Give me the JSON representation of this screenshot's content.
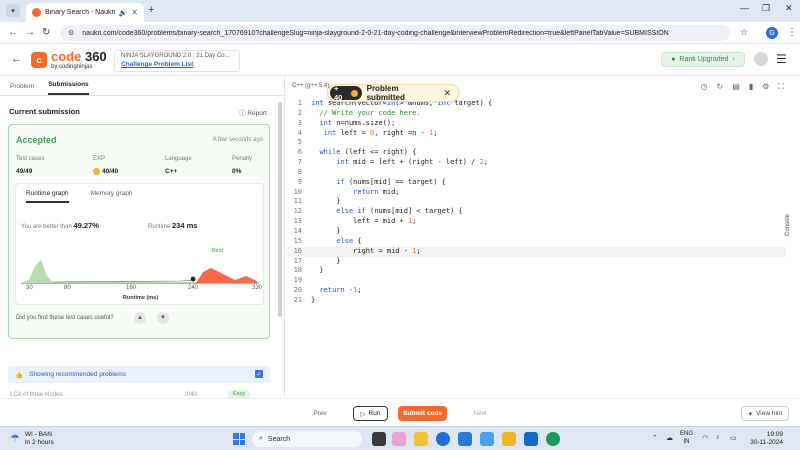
{
  "browser": {
    "tab_title": "Binary Search - Naukri Cod",
    "new_tab": "+",
    "url": "naukri.com/code360/problems/binary-search_17076910?challengeSlug=ninja-slayground-2-0-21-day-coding-challenge&interviewProblemRedirection=true&leftPanelTabValue=SUBMISSION",
    "profile_initial": "G"
  },
  "header": {
    "logo_main": "code",
    "logo_num": "360",
    "logo_sub": "by codingninjas",
    "breadcrumb_top": "NINJA SLAYGROUND 2.0 : 21 Day Co...",
    "breadcrumb_link": "Challenge Problem List",
    "rank_badge": "Rank Upgraded"
  },
  "left": {
    "tabs": [
      "Problem",
      "Submissions"
    ],
    "section_title": "Current submission",
    "report": "Report",
    "status": "Accepted",
    "when": "A few seconds ago",
    "stats": [
      {
        "label": "Test cases",
        "value": "49/49"
      },
      {
        "label": "EXP",
        "value": "40/40"
      },
      {
        "label": "Language",
        "value": "C++"
      },
      {
        "label": "Penalty",
        "value": "0%"
      }
    ],
    "graph_tabs": [
      "Runtime graph",
      "Memory graph"
    ],
    "better_prefix": "You are better than",
    "better_value": "49.27%",
    "runtime_label": "Runtime",
    "runtime_value": "234 ms",
    "best_label": "Best",
    "useful_q": "Did you find these test cases useful?",
    "recommended": "Showing recommended problems",
    "next_problem": "LCA of three Nodes",
    "next_score": "0/40",
    "next_pill": "Easy"
  },
  "chart_data": {
    "type": "area",
    "x_ticks": [
      "30",
      "80",
      "160",
      "240",
      "330"
    ],
    "xlabel": "Runtime (ms)",
    "user_runtime": 234,
    "series": []
  },
  "editor": {
    "lang": "C++ (g++ 5.4)",
    "toast_points": "+ 40",
    "toast_text": "Problem submitted",
    "console": "Console",
    "lines": [
      "int search(vector<int> &nums, int target) {",
      "  // Write your code here.",
      "  int n=nums.size();",
      "   int left = 0, right =n - 1;",
      "",
      "  while (left <= right) {",
      "      int mid = left + (right - left) / 2;",
      "",
      "      if (nums[mid] == target) {",
      "          return mid;",
      "      }",
      "      else if (nums[mid] < target) {",
      "          left = mid + 1;",
      "      }",
      "      else {",
      "          right = mid - 1;",
      "      }",
      "  }",
      "",
      "  return -1;",
      "}"
    ]
  },
  "footer": {
    "prev": "Prev",
    "run": "Run",
    "submit": "Submit code",
    "next": "Next",
    "hint": "View hint"
  },
  "taskbar": {
    "weather_title": "WI - BAN",
    "weather_sub": "In 2 hours",
    "search": "Search",
    "lang_top": "ENG",
    "lang_bottom": "IN",
    "time": "19:09",
    "date": "30-11-2024"
  }
}
